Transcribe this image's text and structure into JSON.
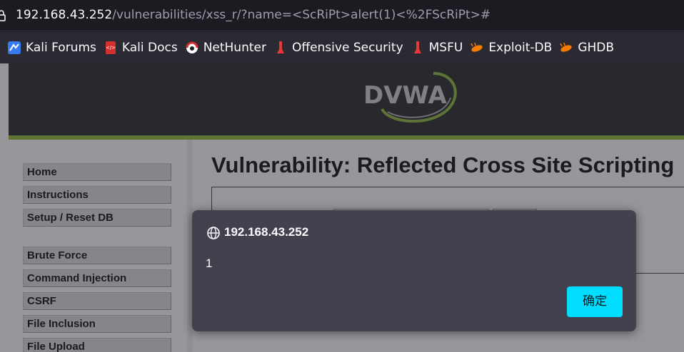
{
  "browser": {
    "url_host": "192.168.43.252",
    "url_path": "/vulnerabilities/xss_r/?name=<ScRiPt>alert(1)<%2FScRiPt>#",
    "bookmarks": [
      {
        "label": "Kali Forums",
        "icon": "kali-forums-icon"
      },
      {
        "label": "Kali Docs",
        "icon": "kali-docs-icon"
      },
      {
        "label": "NetHunter",
        "icon": "nethunter-icon"
      },
      {
        "label": "Offensive Security",
        "icon": "offsec-icon"
      },
      {
        "label": "MSFU",
        "icon": "msfu-icon"
      },
      {
        "label": "Exploit-DB",
        "icon": "exploitdb-icon"
      },
      {
        "label": "GHDB",
        "icon": "ghdb-icon"
      }
    ]
  },
  "dvwa": {
    "logo_text": "DVWA",
    "menu": [
      {
        "label": "Home"
      },
      {
        "label": "Instructions"
      },
      {
        "label": "Setup / Reset DB"
      },
      {
        "label": "Brute Force"
      },
      {
        "label": "Command Injection"
      },
      {
        "label": "CSRF"
      },
      {
        "label": "File Inclusion"
      },
      {
        "label": "File Upload"
      }
    ],
    "page_title": "Vulnerability: Reflected Cross Site Scripting"
  },
  "dialog": {
    "origin": "192.168.43.252",
    "message": "1",
    "ok_label": "确定"
  },
  "colors": {
    "dvwa_green": "#8bb33b",
    "ok_button": "#00ddff",
    "dialog_bg": "#42414d"
  }
}
